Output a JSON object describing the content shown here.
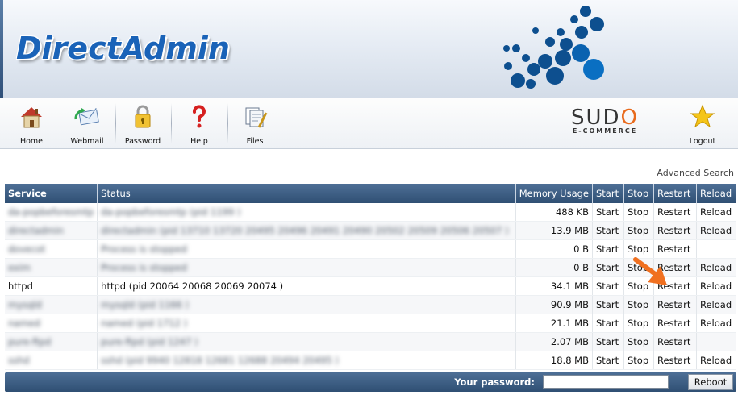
{
  "brand": {
    "title": "DirectAdmin",
    "accent": "#1a63b8",
    "bubble_color": "#0a4d8c"
  },
  "nav": {
    "items": [
      {
        "label": "Home",
        "icon": "home-icon"
      },
      {
        "label": "Webmail",
        "icon": "webmail-icon"
      },
      {
        "label": "Password",
        "icon": "lock-icon"
      },
      {
        "label": "Help",
        "icon": "question-icon"
      },
      {
        "label": "Files",
        "icon": "files-icon"
      }
    ],
    "logout": {
      "label": "Logout",
      "icon": "star-icon"
    }
  },
  "partner": {
    "name_pre": "SUD",
    "name_o": "O",
    "tagline": "E-COMMERCE"
  },
  "advanced_search": "Advanced Search",
  "table": {
    "headers": [
      "Service",
      "Status",
      "Memory Usage",
      "Start",
      "Stop",
      "Restart",
      "Reload"
    ],
    "rows": [
      {
        "service": "da-popbeforesmtp",
        "status": "da-popbeforesmtp (pid 1199 )",
        "memory": "488 KB",
        "start": "Start",
        "stop": "Stop",
        "restart": "Restart",
        "reload": "Reload",
        "blurred": true
      },
      {
        "service": "directadmin",
        "status": "directadmin (pid 13710 13720 20495 20496 20491 20490 20502 20509 20506 20507 )",
        "memory": "13.9 MB",
        "start": "Start",
        "stop": "Stop",
        "restart": "Restart",
        "reload": "Reload",
        "blurred": true
      },
      {
        "service": "dovecot",
        "status": "Process is stopped",
        "memory": "0 B",
        "start": "Start",
        "stop": "Stop",
        "restart": "Restart",
        "reload": "",
        "blurred": true
      },
      {
        "service": "exim",
        "status": "Process is stopped",
        "memory": "0 B",
        "start": "Start",
        "stop": "Stop",
        "restart": "Restart",
        "reload": "Reload",
        "blurred": true
      },
      {
        "service": "httpd",
        "status": "httpd (pid 20064 20068 20069 20074 )",
        "memory": "34.1 MB",
        "start": "Start",
        "stop": "Stop",
        "restart": "Restart",
        "reload": "Reload",
        "blurred": false
      },
      {
        "service": "mysqld",
        "status": "mysqld (pid 1166 )",
        "memory": "90.9 MB",
        "start": "Start",
        "stop": "Stop",
        "restart": "Restart",
        "reload": "Reload",
        "blurred": true
      },
      {
        "service": "named",
        "status": "named (pid 1712 )",
        "memory": "21.1 MB",
        "start": "Start",
        "stop": "Stop",
        "restart": "Restart",
        "reload": "Reload",
        "blurred": true
      },
      {
        "service": "pure-ftpd",
        "status": "pure-ftpd (pid 1247 )",
        "memory": "2.07 MB",
        "start": "Start",
        "stop": "Stop",
        "restart": "Restart",
        "reload": "",
        "blurred": true
      },
      {
        "service": "sshd",
        "status": "sshd (pid 9940 12818 12681 12688 20494 20495 )",
        "memory": "18.8 MB",
        "start": "Start",
        "stop": "Stop",
        "restart": "Restart",
        "reload": "Reload",
        "blurred": true
      }
    ]
  },
  "footer": {
    "password_label": "Your password:",
    "password_value": "",
    "reboot_label": "Reboot"
  },
  "colors": {
    "header_bar": "#3d5f86",
    "arrow": "#f07020"
  }
}
